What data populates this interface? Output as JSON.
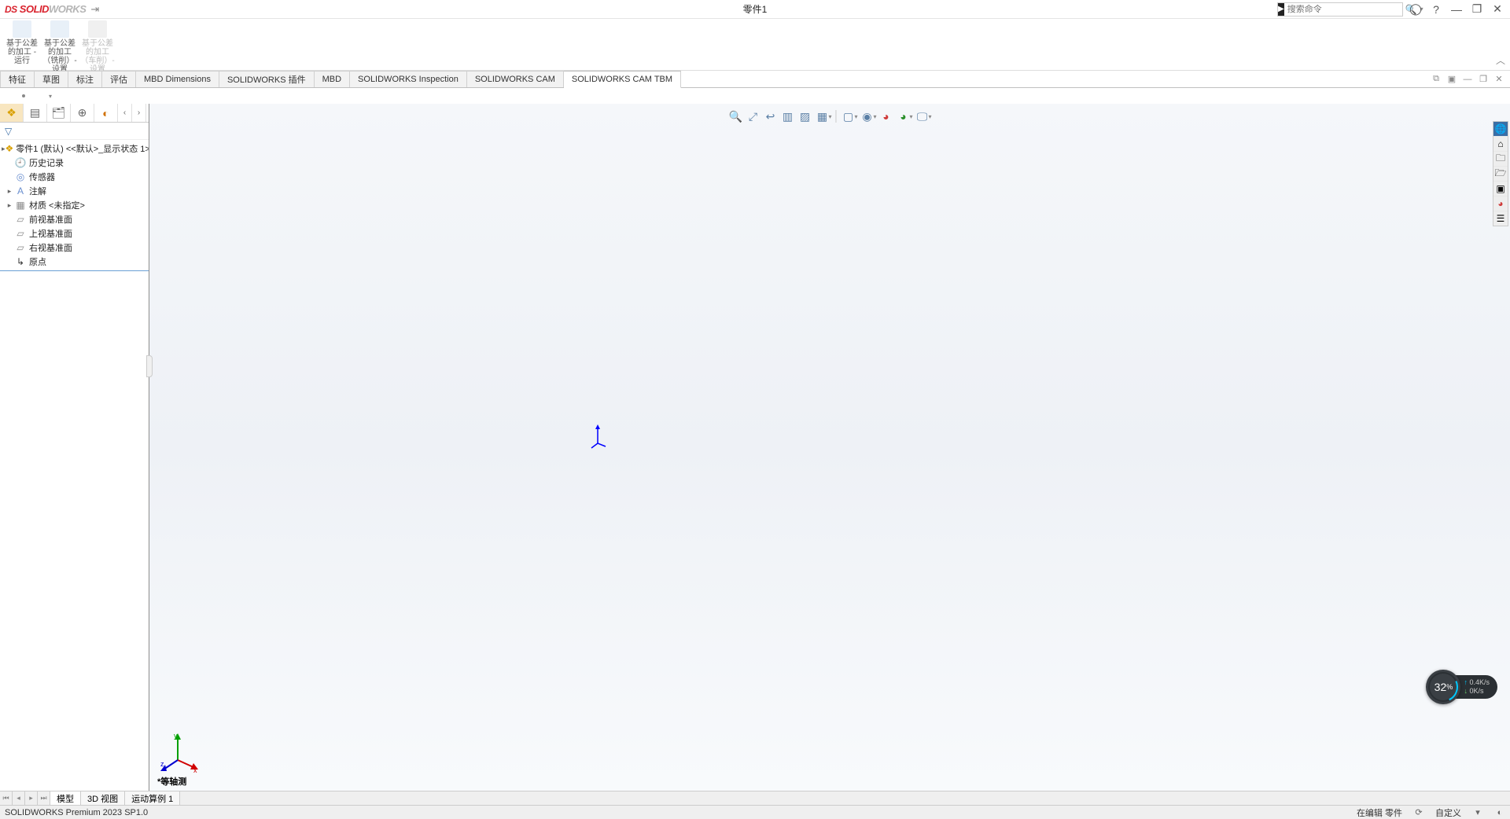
{
  "app": {
    "brand_prefix": "DS",
    "brand1": "SOLID",
    "brand2": "WORKS",
    "doc_title": "零件1",
    "search_placeholder": "搜索命令"
  },
  "ribbon": {
    "items": [
      {
        "label": "基于公差的加工 - 运行",
        "disabled": false
      },
      {
        "label": "基于公差的加工（铣削）- 设置",
        "disabled": false
      },
      {
        "label": "基于公差的加工（车削）- 设置",
        "disabled": true
      }
    ]
  },
  "command_tabs": [
    "特征",
    "草图",
    "标注",
    "评估",
    "MBD Dimensions",
    "SOLIDWORKS 插件",
    "MBD",
    "SOLIDWORKS Inspection",
    "SOLIDWORKS CAM",
    "SOLIDWORKS CAM TBM"
  ],
  "active_command_tab": 9,
  "feature_tree": {
    "root": "零件1 (默认) <<默认>_显示状态 1>",
    "nodes": [
      {
        "label": "历史记录",
        "icon": "history"
      },
      {
        "label": "传感器",
        "icon": "sensor"
      },
      {
        "label": "注解",
        "icon": "annotation",
        "expandable": true
      },
      {
        "label": "材质 <未指定>",
        "icon": "material",
        "expandable": true
      },
      {
        "label": "前视基准面",
        "icon": "plane"
      },
      {
        "label": "上视基准面",
        "icon": "plane"
      },
      {
        "label": "右视基准面",
        "icon": "plane"
      },
      {
        "label": "原点",
        "icon": "origin"
      }
    ]
  },
  "view_orientation": "*等轴测",
  "bottom_tabs": [
    "模型",
    "3D 视图",
    "运动算例 1"
  ],
  "active_bottom_tab": 0,
  "status": {
    "left": "SOLIDWORKS Premium 2023 SP1.0",
    "edit_state": "在编辑 零件",
    "custom": "自定义"
  },
  "perf": {
    "percent": "32",
    "percent_unit": "%",
    "up": "0.4",
    "up_unit": "K/s",
    "down": "0",
    "down_unit": "K/s"
  },
  "triad_axes": {
    "x": "x",
    "y": "y",
    "z": "z"
  }
}
